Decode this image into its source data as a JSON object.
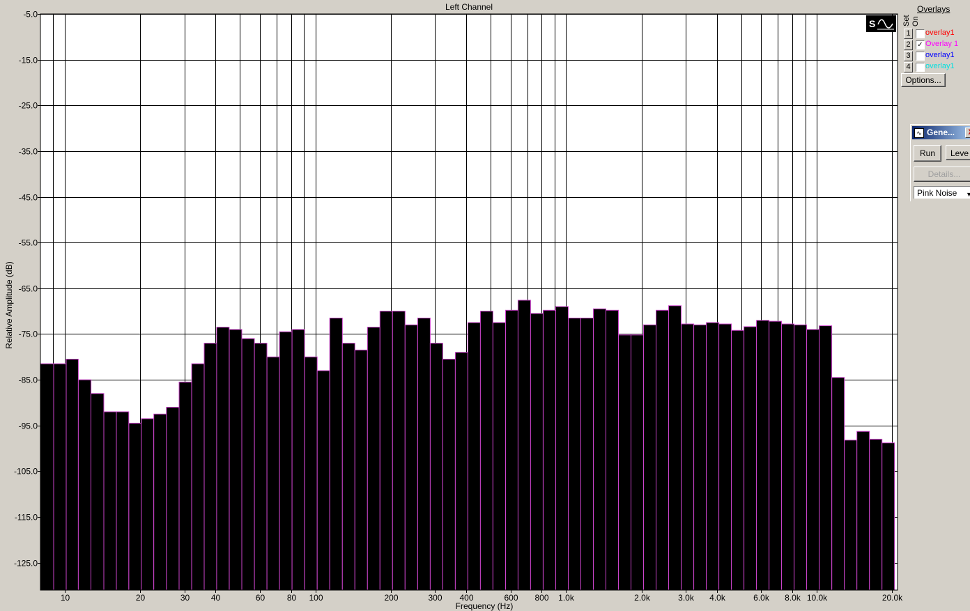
{
  "chart_data": {
    "type": "bar",
    "title": "Left Channel",
    "xlabel": "Frequency (Hz)",
    "ylabel": "Relative Amplitude (dB)",
    "x_scale": "log",
    "xlim": [
      8,
      21000
    ],
    "ylim": [
      -131,
      -5
    ],
    "y_ticks": [
      -5,
      -15,
      -25,
      -35,
      -45,
      -55,
      -65,
      -75,
      -85,
      -95,
      -105,
      -115,
      -125
    ],
    "y_tick_labels": [
      "-5.0",
      "-15.0",
      "-25.0",
      "-35.0",
      "-45.0",
      "-55.0",
      "-65.0",
      "-75.0",
      "-85.0",
      "-95.0",
      "-105.0",
      "-115.0",
      "-125.0"
    ],
    "x_ticks": [
      10,
      20,
      30,
      40,
      60,
      80,
      100,
      200,
      300,
      400,
      600,
      800,
      1000,
      2000,
      3000,
      4000,
      6000,
      8000,
      10000,
      20000
    ],
    "x_tick_labels": [
      "10",
      "20",
      "30",
      "40",
      "60",
      "80",
      "100",
      "200",
      "300",
      "400",
      "600",
      "800",
      "1.0k",
      "2.0k",
      "3.0k",
      "4.0k",
      "6.0k",
      "8.0k",
      "10.0k",
      "20.0k"
    ],
    "x_gridlines": [
      9,
      10,
      20,
      30,
      40,
      50,
      60,
      70,
      80,
      90,
      100,
      200,
      300,
      400,
      500,
      600,
      700,
      800,
      900,
      1000,
      2000,
      3000,
      4000,
      5000,
      6000,
      7000,
      8000,
      9000,
      10000,
      20000
    ],
    "grid": true,
    "bar_fill": "#000000",
    "bar_edge": "#cc44cc",
    "bar_center_freqs": [
      8.5,
      9.6,
      10.7,
      12.0,
      13.5,
      15.2,
      17.0,
      19.1,
      21.4,
      24.0,
      27.0,
      30.3,
      34.0,
      38.1,
      42.8,
      48.0,
      53.9,
      60.5,
      67.9,
      76.2,
      85.5,
      96.0,
      107.7,
      120.9,
      135.7,
      152.2,
      170.9,
      191.7,
      215.2,
      241.5,
      271.0,
      304.1,
      341.3,
      383.0,
      429.8,
      482.3,
      541.3,
      607.4,
      681.5,
      764.8,
      858.3,
      963.1,
      1080.8,
      1212.8,
      1361.0,
      1527.3,
      1713.9,
      1923.2,
      2158.2,
      2421.9,
      2717.8,
      3049.8,
      3422.4,
      3840.6,
      4309.8,
      4836.3,
      5427.2,
      6090.3,
      6834.3,
      7669.3,
      8606.2,
      9657.7,
      10837.6,
      12161.6,
      13647.4,
      15314.7,
      17185.7,
      19285.3
    ],
    "series": [
      {
        "name": "Overlay 1",
        "values": [
          -81.5,
          -81.5,
          -80.5,
          -85.0,
          -88.0,
          -92.0,
          -92.0,
          -94.5,
          -93.5,
          -92.5,
          -91.0,
          -85.5,
          -81.5,
          -77.0,
          -73.5,
          -74.0,
          -76.0,
          -77.0,
          -80.0,
          -74.5,
          -74.0,
          -80.0,
          -83.0,
          -71.5,
          -77.0,
          -78.5,
          -73.5,
          -70.0,
          -70.0,
          -73.0,
          -71.5,
          -77.0,
          -80.5,
          -79.0,
          -72.5,
          -70.0,
          -72.5,
          -69.8,
          -67.6,
          -70.5,
          -69.8,
          -69.0,
          -71.5,
          -71.5,
          -69.5,
          -69.8,
          -75.2,
          -75.2,
          -73.0,
          -69.8,
          -68.8,
          -72.8,
          -73.0,
          -72.5,
          -72.8,
          -74.2,
          -73.4,
          -72.0,
          -72.2,
          -72.8,
          -73.0,
          -74.0,
          -73.2,
          -84.5,
          -98.2,
          -96.3,
          -98.0,
          -98.8
        ]
      }
    ]
  },
  "overlays": {
    "title": "Overlays",
    "col_set": "Set",
    "col_on": "On",
    "rows": [
      {
        "num": "1",
        "checked": false,
        "name": "overlay1",
        "color": "#ff0000"
      },
      {
        "num": "2",
        "checked": true,
        "name": "Overlay 1",
        "color": "#ff00ff"
      },
      {
        "num": "3",
        "checked": false,
        "name": "overlay1",
        "color": "#0000ff"
      },
      {
        "num": "4",
        "checked": false,
        "name": "overlay1",
        "color": "#00e0e0"
      }
    ],
    "options_label": "Options..."
  },
  "generator": {
    "title": "Gene...",
    "close_label": "X",
    "run_label": "Run",
    "level_label": "Leve",
    "details_label": "Details...",
    "signal": "Pink Noise"
  }
}
